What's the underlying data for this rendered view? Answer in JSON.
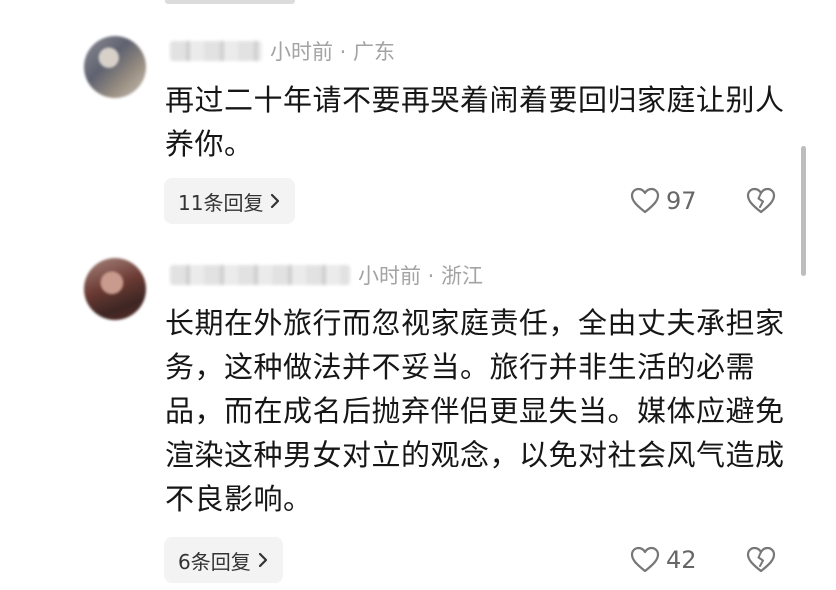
{
  "comments": [
    {
      "meta": "小时前 · 广东",
      "text": "再过二十年请不要再哭着闹着要回归家庭让别人养你。",
      "replies_label": "11条回复",
      "likes": "97",
      "icons": {
        "like": "heart-outline-icon",
        "dislike": "broken-heart-icon",
        "chevron": "chevron-right-icon"
      }
    },
    {
      "meta": "小时前 · 浙江",
      "text": "长期在外旅行而忽视家庭责任，全由丈夫承担家务，这种做法并不妥当。旅行并非生活的必需品，而在成名后抛弃伴侣更显失当。媒体应避免渲染这种男女对立的观念，以免对社会风气造成不良影响。",
      "replies_label": "6条回复",
      "likes": "42",
      "icons": {
        "like": "heart-outline-icon",
        "dislike": "broken-heart-icon",
        "chevron": "chevron-right-icon"
      }
    }
  ]
}
